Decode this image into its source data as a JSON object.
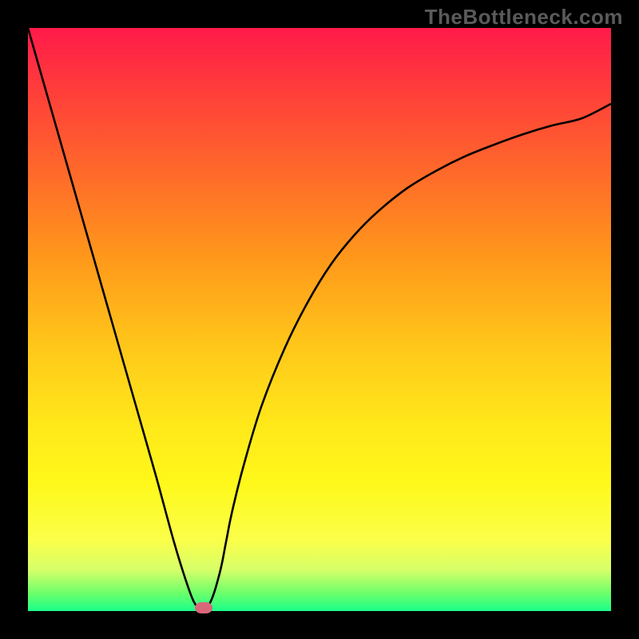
{
  "watermark": "TheBottleneck.com",
  "chart_data": {
    "type": "line",
    "title": "",
    "xlabel": "",
    "ylabel": "",
    "xlim": [
      0,
      100
    ],
    "ylim": [
      0,
      100
    ],
    "x": [
      0,
      2,
      5,
      8,
      10,
      13,
      16,
      19,
      22,
      25,
      27,
      28.5,
      30,
      31.5,
      33,
      34,
      35,
      37,
      40,
      44,
      48,
      52,
      56,
      60,
      65,
      70,
      75,
      80,
      85,
      90,
      95,
      100
    ],
    "y": [
      100,
      93,
      82.5,
      72,
      65,
      54.5,
      44,
      33.5,
      23,
      12,
      5.5,
      1.5,
      0,
      2,
      7,
      12,
      17,
      25,
      35,
      45,
      53,
      59.5,
      64.5,
      68.5,
      72.5,
      75.5,
      78,
      80,
      81.8,
      83.3,
      84.5,
      87
    ],
    "marker": {
      "x": 30.2,
      "y": 0.5
    },
    "background_gradient": {
      "top": "#ff1a4a",
      "mid": "#ffe81a",
      "bottom": "#1aff8a"
    },
    "curve_color": "#000000"
  }
}
